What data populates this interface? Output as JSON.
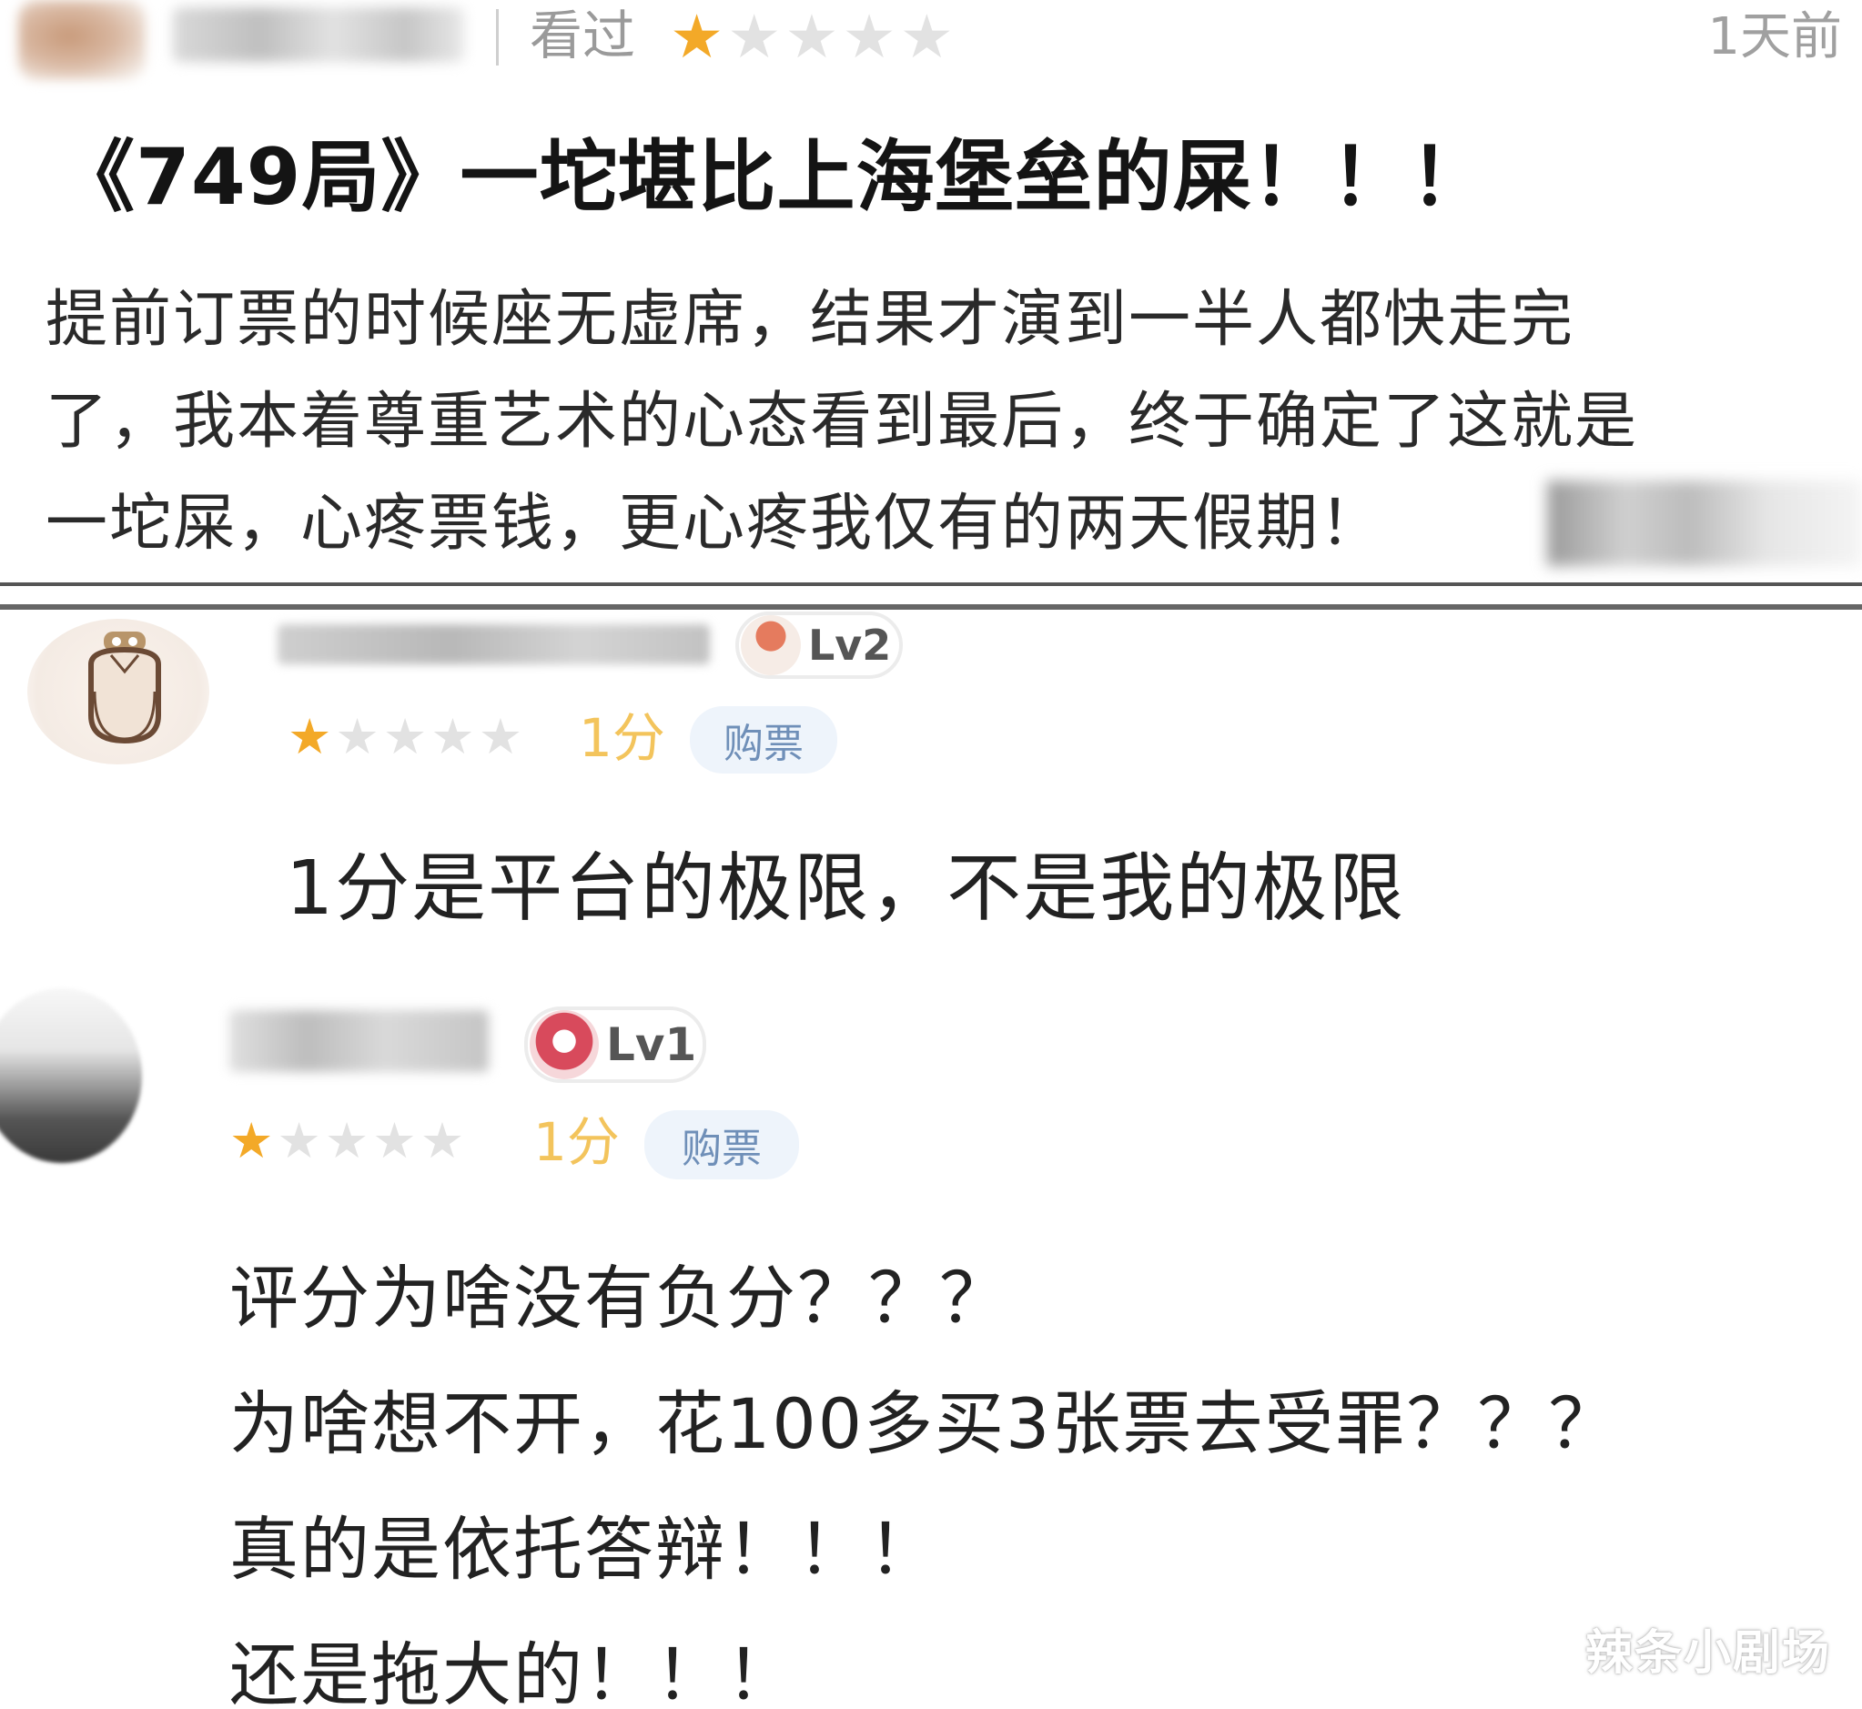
{
  "review1": {
    "watched_label": "看过",
    "rating": 1,
    "stars_total": 5,
    "time": "1天前",
    "title": "《749局》一坨堪比上海堡垒的屎！！！",
    "body_lines": [
      "提前订票的时候座无虚席，结果才演到一半人都快走完",
      "了，我本着尊重艺术的心态看到最后，终于确定了这就是",
      "一坨屎，心疼票钱，更心疼我仅有的两天假期！"
    ]
  },
  "comment2": {
    "level_label": "Lv2",
    "rating": 1,
    "stars_total": 5,
    "score_label": "1分",
    "tag_label": "购票",
    "text": "1分是平台的极限，不是我的极限"
  },
  "comment3": {
    "level_label": "Lv1",
    "rating": 1,
    "stars_total": 5,
    "score_label": "1分",
    "tag_label": "购票",
    "text_lines": [
      "评分为啥没有负分？？？",
      "为啥想不开，花100多买3张票去受罪？？？",
      "真的是依托答辩！！！",
      "还是拖大的！！！"
    ]
  },
  "watermark": "辣条小剧场",
  "icons": {
    "star_filled": "star-filled-icon",
    "star_empty": "star-empty-icon",
    "level_badge": "level-badge-icon",
    "avatar": "avatar-icon"
  },
  "colors": {
    "star_on": "#f3a928",
    "star_off": "#e2e2e2",
    "score": "#f3c45c",
    "tag_bg": "#eef4fb",
    "tag_text": "#6f8fb8"
  }
}
